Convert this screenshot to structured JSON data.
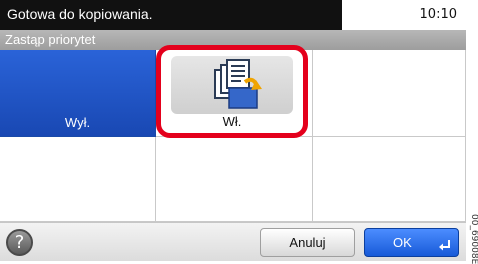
{
  "status": {
    "message": "Gotowa do kopiowania.",
    "time": "10:10"
  },
  "title": "Zastąp priorytet",
  "options": {
    "off_label": "Wył.",
    "on_label": "Wł."
  },
  "buttons": {
    "cancel": "Anuluj",
    "ok": "OK",
    "help": "?"
  },
  "side_code": "00_69008E",
  "icons": {
    "on_option": "copy-documents-icon",
    "help": "help-icon",
    "ok": "enter-arrow-icon"
  },
  "colors": {
    "selected_blue": "#1e52c4",
    "highlight_red": "#e4001c"
  }
}
